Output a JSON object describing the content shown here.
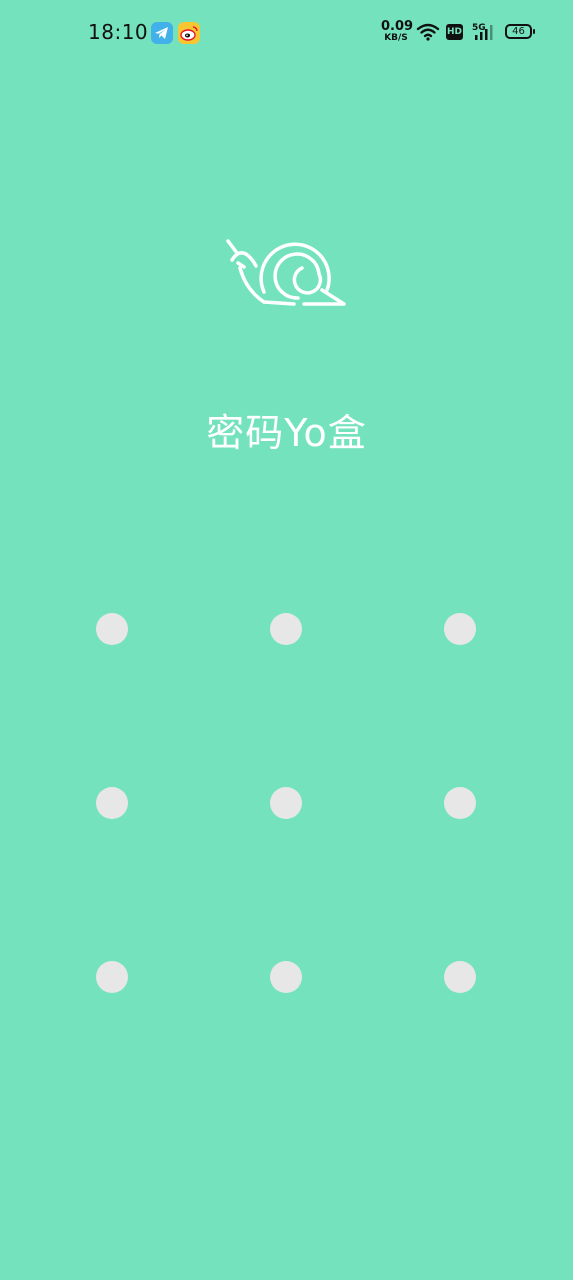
{
  "status_bar": {
    "time": "18:10",
    "notification_icons": [
      "telegram-icon",
      "weibo-icon"
    ],
    "network_speed_value": "0.09",
    "network_speed_unit": "KB/S",
    "hd_label": "HD",
    "network_type": "5G",
    "battery_level": "46"
  },
  "app": {
    "logo_icon": "snail-icon",
    "title": "密码Yo盒"
  },
  "pattern_lock": {
    "rows": 3,
    "columns": 3,
    "dot_color": "#e7e7e7"
  },
  "colors": {
    "background": "#74e3bd",
    "logo_stroke": "#ffffff",
    "status_text": "#111111"
  }
}
